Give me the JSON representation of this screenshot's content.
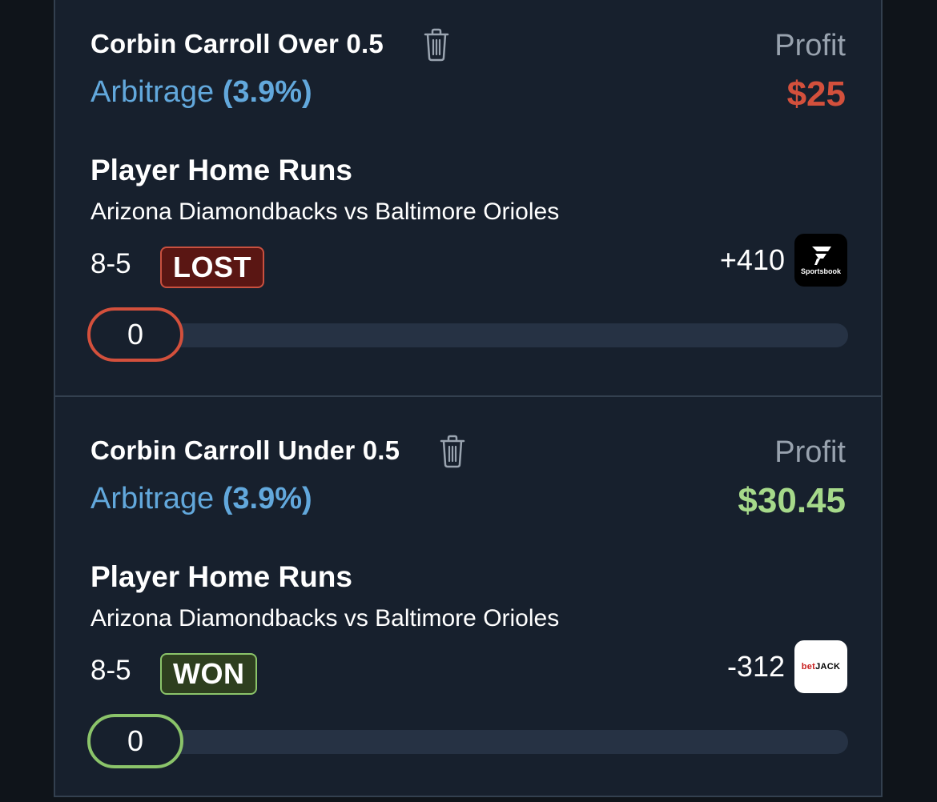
{
  "colors": {
    "background": "#0f141a",
    "panel": "#17202d",
    "arbitrage_blue": "#62a8dc",
    "loss_red": "#d3503c",
    "win_green": "#a6d98a",
    "lost_badge_bg": "#5a1613",
    "lost_badge_border": "#c9503f",
    "won_badge_bg": "#2e3f1f",
    "won_badge_border": "#8bc46a"
  },
  "bets": [
    {
      "title": "Corbin Carroll Over 0.5",
      "trash_icon": "trash-icon",
      "arbitrage_label": "Arbitrage",
      "arbitrage_pct": "(3.9%)",
      "profit_label": "Profit",
      "profit_value": "$25",
      "profit_color": "#d3503c",
      "market": "Player Home Runs",
      "game": "Arizona Diamondbacks vs Baltimore Orioles",
      "score": "8-5",
      "result": "LOST",
      "odds": "+410",
      "book_icon": "fanatics-sportsbook-logo",
      "book_caption": "Sportsbook",
      "slider_value": "0",
      "slider_color": "#d3503c"
    },
    {
      "title": "Corbin Carroll Under 0.5",
      "trash_icon": "trash-icon",
      "arbitrage_label": "Arbitrage",
      "arbitrage_pct": "(3.9%)",
      "profit_label": "Profit",
      "profit_value": "$30.45",
      "profit_color": "#a6d98a",
      "market": "Player Home Runs",
      "game": "Arizona Diamondbacks vs Baltimore Orioles",
      "score": "8-5",
      "result": "WON",
      "odds": "-312",
      "book_icon": "betjack-logo",
      "book_logo_bet": "bet",
      "book_logo_jack": "JACK",
      "slider_value": "0",
      "slider_color": "#8bc46a"
    }
  ]
}
